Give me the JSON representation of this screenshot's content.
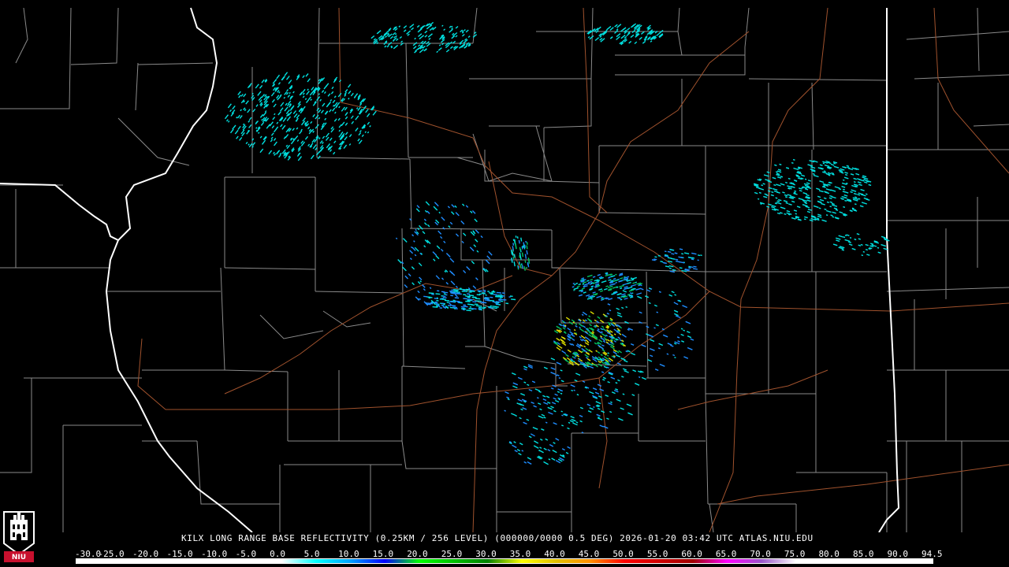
{
  "title": "KILX LONG RANGE BASE REFLECTIVITY (0.25KM / 256 LEVEL) (000000/0000 0.5 DEG) 2026-01-20 03:42 UTC  ATLAS.NIU.EDU",
  "logo": {
    "icon": "niu-logo-icon",
    "text": "NIU"
  },
  "scale": {
    "labels": [
      "-30.0",
      "-25.0",
      "-20.0",
      "-15.0",
      "-10.0",
      "-5.0",
      "0.0",
      "5.0",
      "10.0",
      "15.0",
      "20.0",
      "25.0",
      "30.0",
      "35.0",
      "40.0",
      "45.0",
      "50.0",
      "55.0",
      "60.0",
      "65.0",
      "70.0",
      "75.0",
      "80.0",
      "85.0",
      "90.0",
      "94.5"
    ],
    "colors": [
      "#ffffff",
      "#ffffff",
      "#ffffff",
      "#ffffff",
      "#ffffff",
      "#ffffff",
      "#ffffff",
      "#00ffff",
      "#00a0ff",
      "#0000ff",
      "#00ff00",
      "#00c000",
      "#008000",
      "#ffff00",
      "#e0c000",
      "#ff9000",
      "#ff0000",
      "#d00000",
      "#a00000",
      "#ff00ff",
      "#9955c9",
      "#ffffff",
      "#ffffff",
      "#ffffff",
      "#ffffff",
      "#ffffff"
    ]
  },
  "colors": {
    "background": "#000000",
    "state_border": "#ffffff",
    "county_border": "#8a8a8a",
    "highway": "#a0522d",
    "echo_light": "#00e0e0",
    "echo_blue": "#1e8cff",
    "echo_green": "#00c060",
    "echo_yellow": "#e0e000"
  }
}
